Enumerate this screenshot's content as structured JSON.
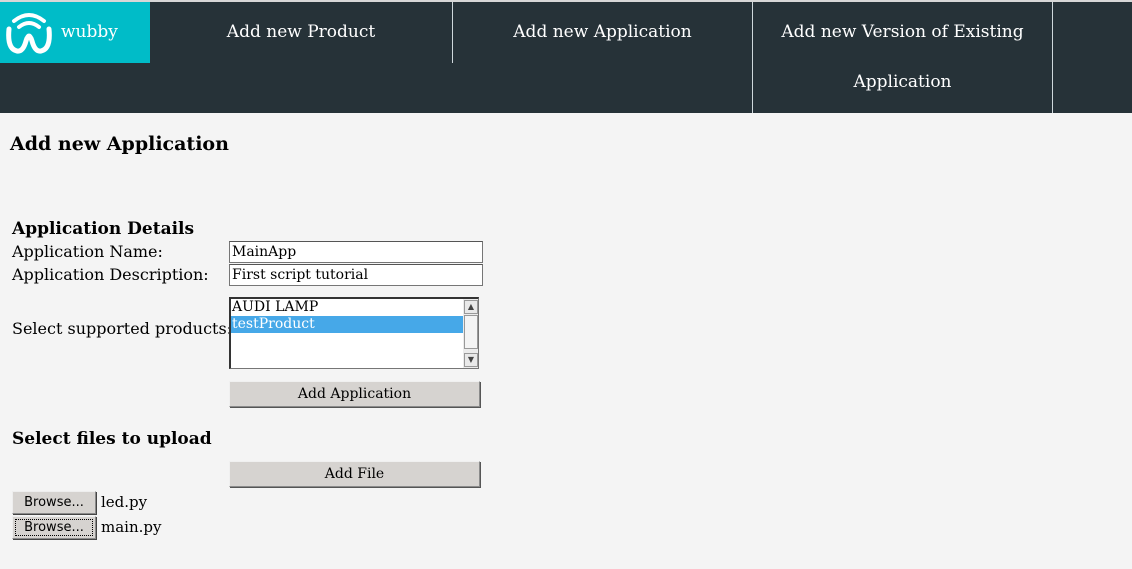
{
  "colors": {
    "nav_background": "#263238",
    "brand_background": "#00bcc8",
    "page_background": "#f4f4f4",
    "selected_option": "#46a8e8"
  },
  "brand": {
    "name": "wubby",
    "logo_icon": "wubby-logo-icon"
  },
  "nav": {
    "items": [
      {
        "label": "Add new Product"
      },
      {
        "label": "Add new Application"
      },
      {
        "label_line1": "Add new Version of Existing",
        "label_line2": "Application"
      }
    ]
  },
  "page": {
    "title": "Add new Application"
  },
  "details": {
    "heading": "Application Details",
    "name_label": "Application Name:",
    "name_value": "MainApp",
    "description_label": "Application Description:",
    "description_value": "First script tutorial",
    "products_label": "Select supported products:",
    "products": [
      {
        "label": "AUDI LAMP",
        "selected": false
      },
      {
        "label": "testProduct",
        "selected": true
      }
    ],
    "submit_label": "Add Application"
  },
  "upload": {
    "heading": "Select files to upload",
    "add_file_label": "Add File",
    "files": [
      {
        "button_label": "Browse...",
        "file_name": "led.py"
      },
      {
        "button_label": "Browse...",
        "file_name": "main.py"
      }
    ]
  }
}
